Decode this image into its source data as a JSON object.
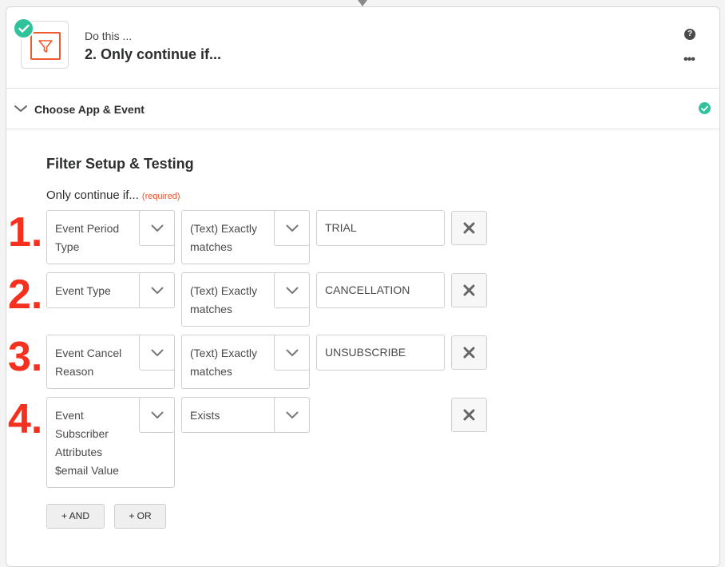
{
  "step": {
    "kicker": "Do this ...",
    "title": "2. Only continue if..."
  },
  "section": {
    "title": "Choose App & Event"
  },
  "filter": {
    "heading": "Filter Setup & Testing",
    "label": "Only continue if...",
    "required": "(required)",
    "rows": [
      {
        "num": "1.",
        "field": "Event Period Type",
        "condition": "(Text) Exactly matches",
        "value": "TRIAL"
      },
      {
        "num": "2.",
        "field": "Event Type",
        "condition": "(Text) Exactly matches",
        "value": "CANCELLATION"
      },
      {
        "num": "3.",
        "field": "Event Cancel Reason",
        "condition": "(Text) Exactly matches",
        "value": "UNSUBSCRIBE"
      },
      {
        "num": "4.",
        "field": "Event Subscriber Attributes $email Value",
        "condition": "Exists",
        "value": ""
      }
    ],
    "and_label": "+ AND",
    "or_label": "+ OR"
  },
  "colors": {
    "accent_green": "#2fc29b",
    "filter_orange": "#ee5b2f",
    "annotation_red": "#f5301f",
    "required_red": "#e8512a"
  },
  "icons": [
    "filter-icon",
    "check-icon",
    "help-icon",
    "more-icon",
    "chevron-down-icon",
    "close-icon"
  ]
}
